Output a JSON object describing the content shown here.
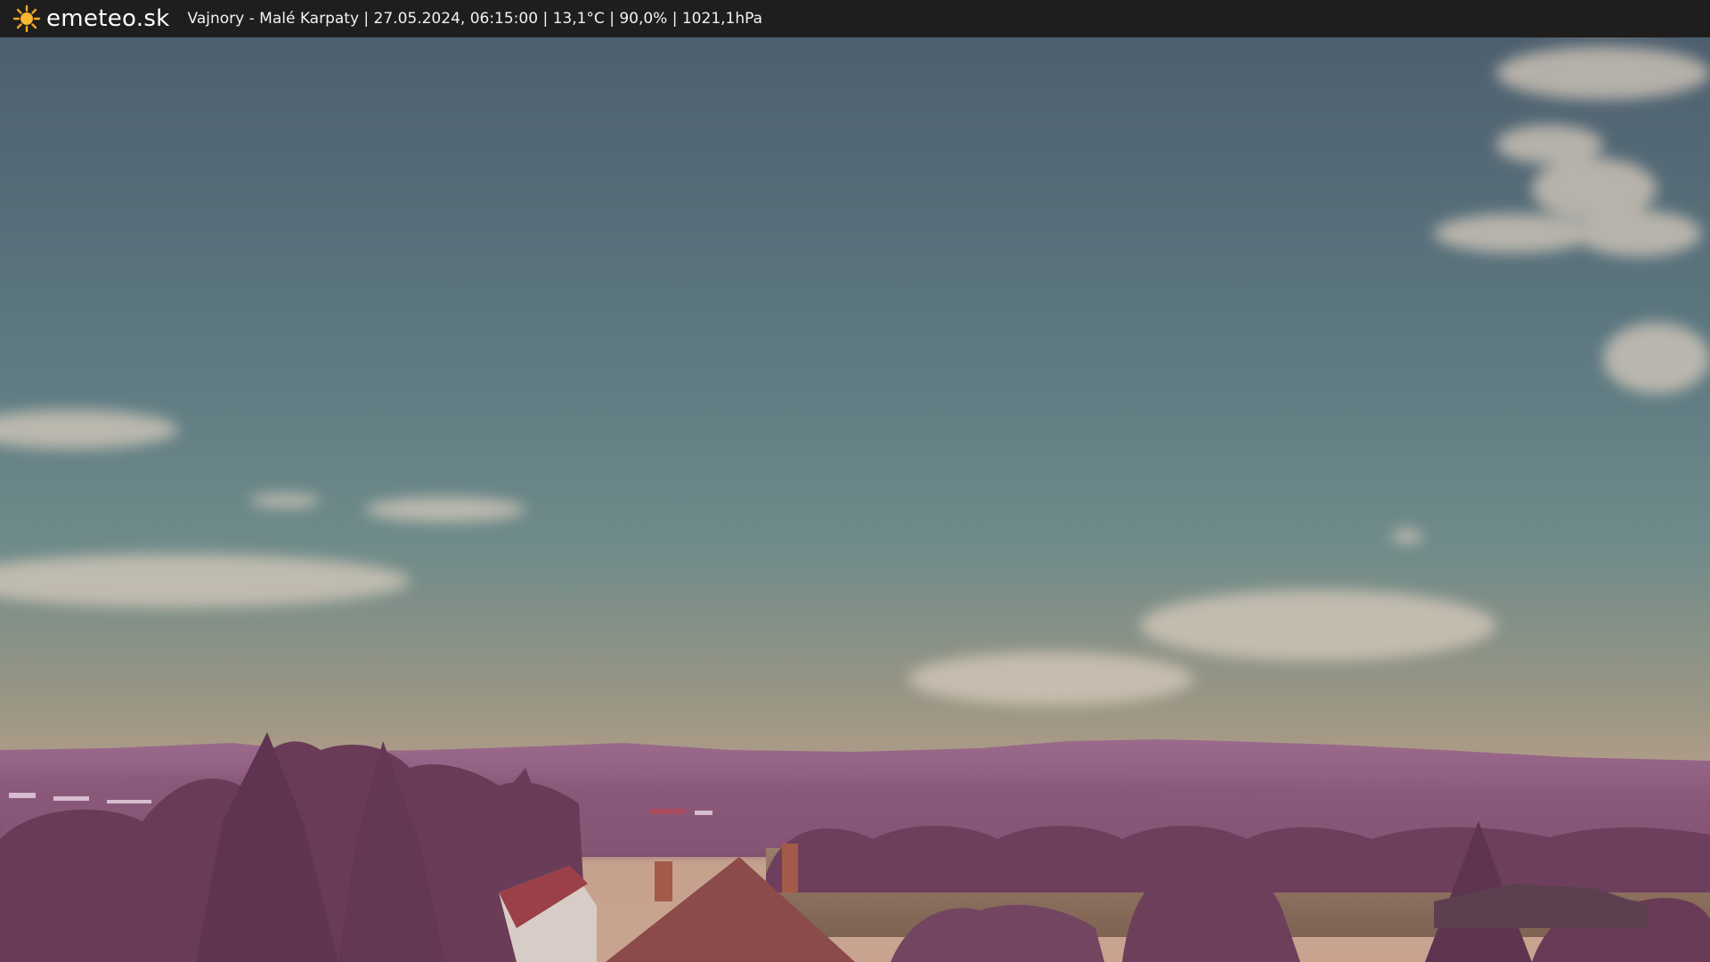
{
  "header": {
    "brand": "emeteo.sk",
    "brand_icon": "sun-icon",
    "caption": "Vajnory - Malé Karpaty | 27.05.2024, 06:15:00 | 13,1°C | 90,0% | 1021,1hPa"
  },
  "colors": {
    "topbar": "#1e1e1e",
    "sun": "#f5a623",
    "sky_top": "#4f6270",
    "sky_mid": "#6b8a8c",
    "sky_horizon": "#b79a85",
    "hills": "#8a5a7a",
    "foliage": "#6b3e58",
    "field": "#8c7060"
  }
}
